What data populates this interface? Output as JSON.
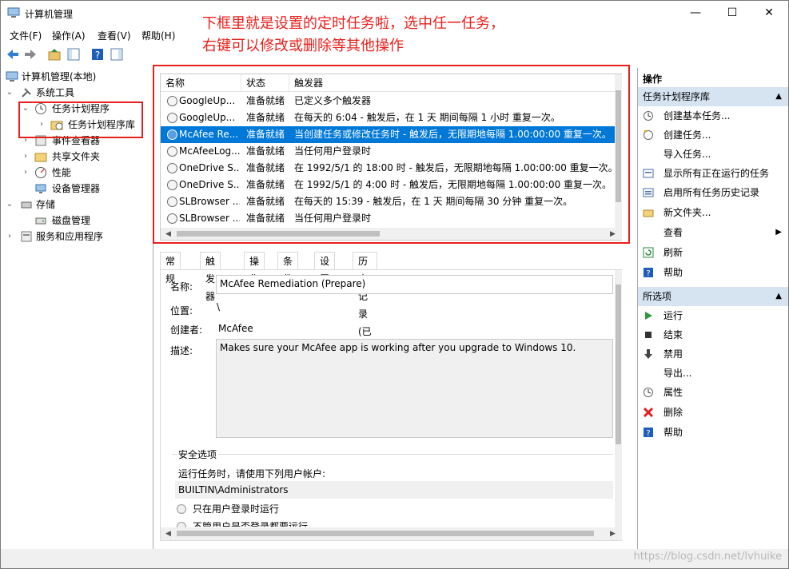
{
  "window": {
    "title": "计算机管理",
    "controls": [
      "—",
      "☐",
      "✕"
    ]
  },
  "menu": [
    "文件(F)",
    "操作(A)",
    "查看(V)",
    "帮助(H)"
  ],
  "annotation": {
    "line1": "下框里就是设置的定时任务啦，选中任一任务，",
    "line2": "右键可以修改或删除等其他操作"
  },
  "tree": {
    "root": "计算机管理(本地)",
    "system_tools": "系统工具",
    "task_scheduler": "任务计划程序",
    "task_library": "任务计划程序库",
    "event_viewer": "事件查看器",
    "shared_folders": "共享文件夹",
    "performance": "性能",
    "device_manager": "设备管理器",
    "storage": "存储",
    "disk_management": "磁盘管理",
    "services_apps": "服务和应用程序"
  },
  "tasklist": {
    "columns": [
      "名称",
      "状态",
      "触发器"
    ],
    "rows": [
      {
        "name": "GoogleUp...",
        "status": "准备就绪",
        "trigger": "已定义多个触发器"
      },
      {
        "name": "GoogleUp...",
        "status": "准备就绪",
        "trigger": "在每天的 6:04 - 触发后，在 1 天 期间每隔 1 小时 重复一次。"
      },
      {
        "name": "McAfee Re...",
        "status": "准备就绪",
        "trigger": "当创建任务或修改任务时 - 触发后，无限期地每隔 1.00:00:00 重复一次。",
        "selected": true
      },
      {
        "name": "McAfeeLog...",
        "status": "准备就绪",
        "trigger": "当任何用户登录时"
      },
      {
        "name": "OneDrive S...",
        "status": "准备就绪",
        "trigger": "在 1992/5/1 的 18:00 时 - 触发后，无限期地每隔 1.00:00:00 重复一次。"
      },
      {
        "name": "OneDrive S...",
        "status": "准备就绪",
        "trigger": "在 1992/5/1 的 4:00 时 - 触发后，无限期地每隔 1.00:00:00 重复一次。"
      },
      {
        "name": "SLBrowser ...",
        "status": "准备就绪",
        "trigger": "在每天的 15:39 - 触发后，在 1 天 期间每隔 30 分钟 重复一次。"
      },
      {
        "name": "SLBrowser ...",
        "status": "准备就绪",
        "trigger": "当任何用户登录时"
      }
    ]
  },
  "tabs": [
    "常规",
    "触发器",
    "操作",
    "条件",
    "设置",
    "历史记录(已禁用)"
  ],
  "detail": {
    "name_label": "名称:",
    "name_value": "McAfee Remediation (Prepare)",
    "location_label": "位置:",
    "location_value": "\\",
    "author_label": "创建者:",
    "author_value": "McAfee",
    "desc_label": "描述:",
    "desc_value": "Makes sure your McAfee app is working after you upgrade to Windows 10.",
    "security_title": "安全选项",
    "run_as_label": "运行任务时，请使用下列用户帐户:",
    "run_as_value": "BUILTIN\\Administrators",
    "radio1": "只在用户登录时运行",
    "radio2": "不管用户是否登录都要运行"
  },
  "actions": {
    "header": "操作",
    "section1": "任务计划程序库",
    "items1": [
      {
        "label": "创建基本任务...",
        "icon": "create-basic-task-icon"
      },
      {
        "label": "创建任务...",
        "icon": "create-task-icon"
      },
      {
        "label": "导入任务...",
        "icon": ""
      },
      {
        "label": "显示所有正在运行的任务",
        "icon": "running-tasks-icon"
      },
      {
        "label": "启用所有任务历史记录",
        "icon": "history-icon"
      },
      {
        "label": "新文件夹...",
        "icon": "new-folder-icon"
      },
      {
        "label": "查看",
        "icon": "",
        "submenu": true
      },
      {
        "label": "刷新",
        "icon": "refresh-icon"
      },
      {
        "label": "帮助",
        "icon": "help-icon"
      }
    ],
    "section2": "所选项",
    "items2": [
      {
        "label": "运行",
        "icon": "run-icon"
      },
      {
        "label": "结束",
        "icon": "stop-icon"
      },
      {
        "label": "禁用",
        "icon": "disable-icon"
      },
      {
        "label": "导出...",
        "icon": ""
      },
      {
        "label": "属性",
        "icon": "properties-icon"
      },
      {
        "label": "删除",
        "icon": "delete-icon"
      },
      {
        "label": "帮助",
        "icon": "help-icon"
      }
    ]
  },
  "watermark": "https://blog.csdn.net/lvhuike",
  "colors": {
    "annotation": "#e8201c",
    "selection": "#0078d7",
    "section_header": "#d6e4f2"
  }
}
